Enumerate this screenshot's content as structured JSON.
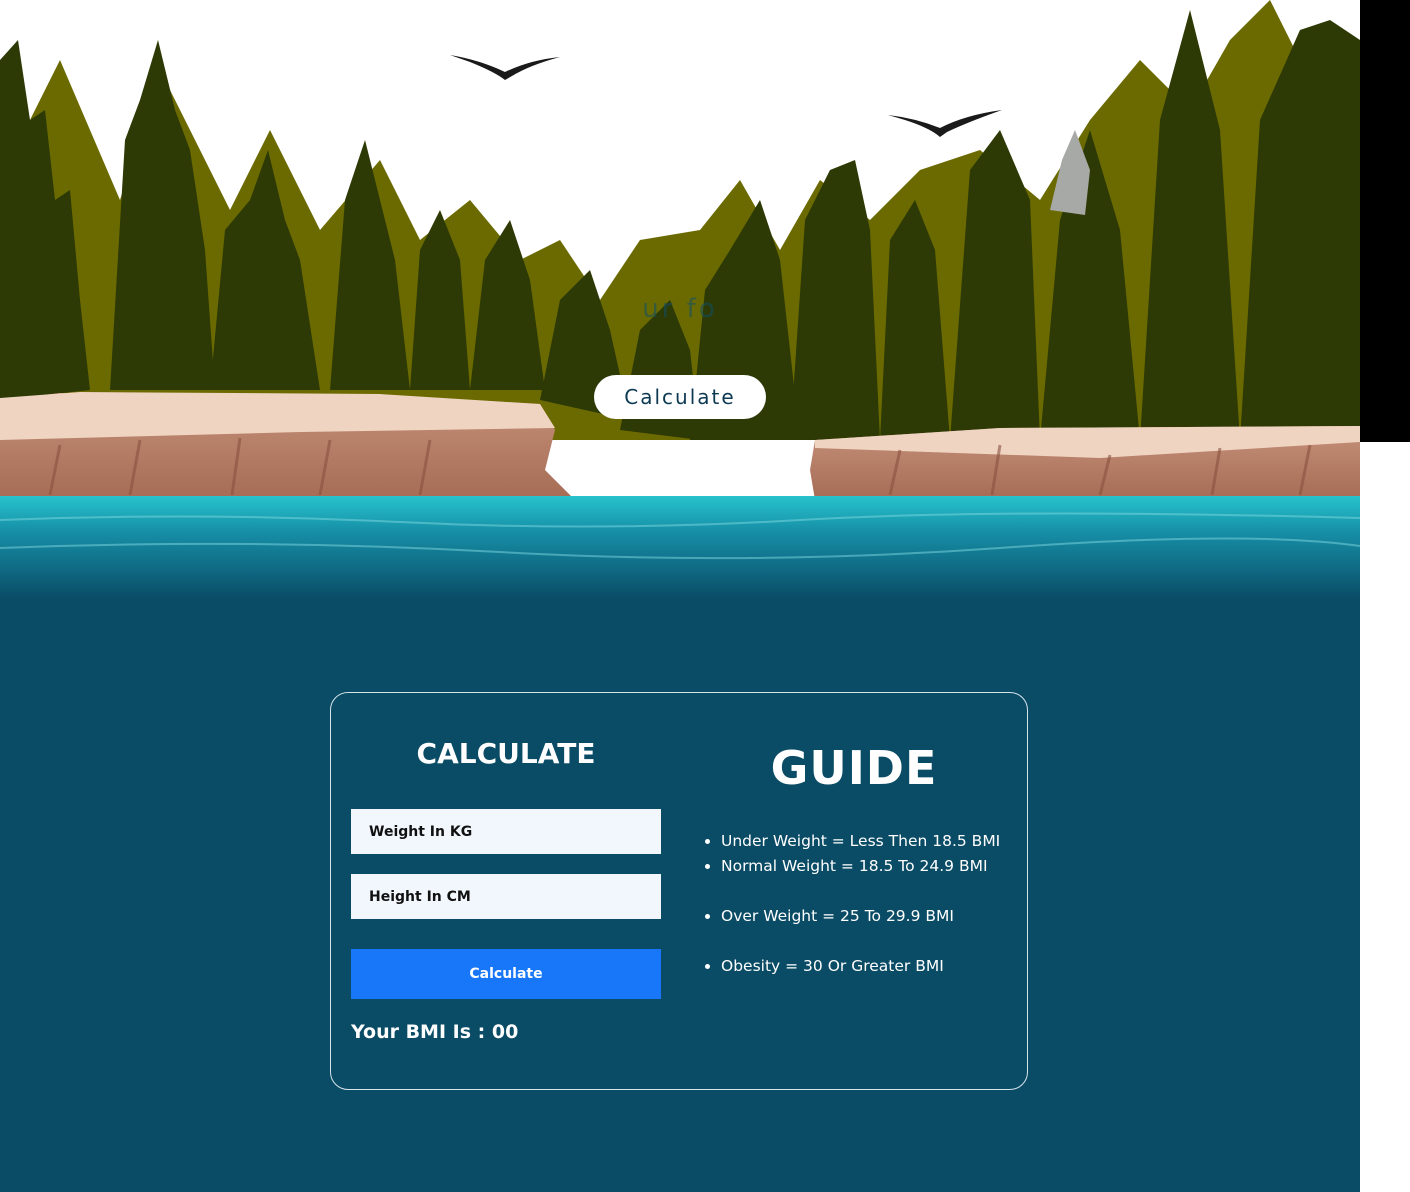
{
  "hero": {
    "subtitle": "ur fo",
    "calculate_button": "Calculate"
  },
  "calculator": {
    "title": "CALCULATE",
    "weight_placeholder": "Weight In KG",
    "height_placeholder": "Height In CM",
    "button_label": "Calculate",
    "result_label": "Your BMI Is : 00"
  },
  "guide": {
    "title": "GUIDE",
    "items": [
      "Under Weight = Less Then 18.5 BMI",
      "Normal Weight = 18.5 To 24.9 BMI",
      "Over Weight = 25 To 29.9 BMI",
      "Obesity = 30 Or Greater BMI"
    ]
  },
  "colors": {
    "page_background": "#0a4b65",
    "button_blue": "#1877f8",
    "input_background": "#f2f7fd",
    "tree_olive": "#6b6a00",
    "tree_dark": "#2d3a06",
    "water": "#0f8fa5"
  }
}
